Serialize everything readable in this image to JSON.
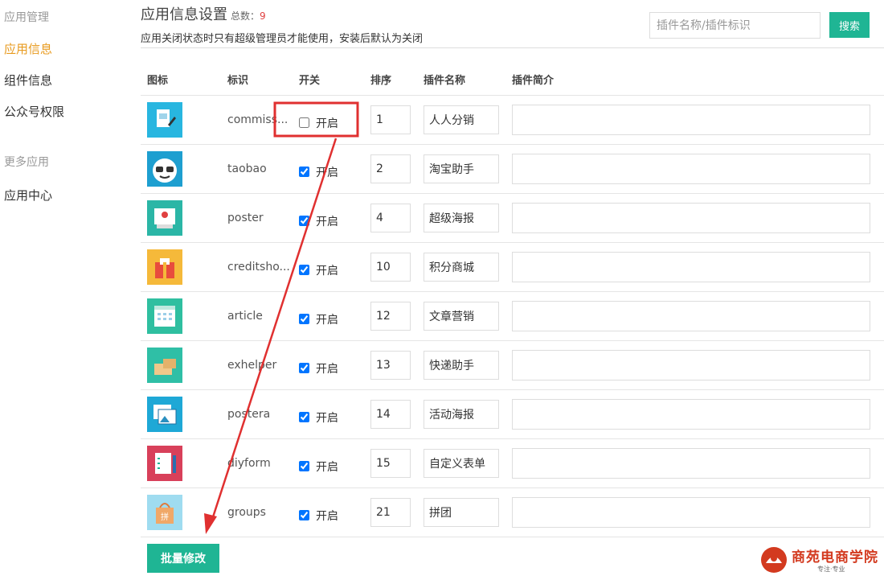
{
  "sidebar": {
    "group1": "应用管理",
    "items1": [
      "应用信息",
      "组件信息",
      "公众号权限"
    ],
    "group2": "更多应用",
    "items2": [
      "应用中心"
    ]
  },
  "header": {
    "title": "应用信息设置",
    "count_label": "总数：",
    "count_value": "9",
    "subtitle": "应用关闭状态时只有超级管理员才能使用，安装后默认为关闭"
  },
  "search": {
    "placeholder": "插件名称/插件标识",
    "button": "搜索"
  },
  "table": {
    "headers": [
      "图标",
      "标识",
      "开关",
      "排序",
      "插件名称",
      "插件简介"
    ],
    "switch_label": "开启",
    "rows": [
      {
        "ident": "commiss...",
        "checked": false,
        "order": "1",
        "name": "人人分销",
        "icon": "commission-icon",
        "color": "#28b6e0"
      },
      {
        "ident": "taobao",
        "checked": true,
        "order": "2",
        "name": "淘宝助手",
        "icon": "taobao-glasses-icon",
        "color": "#1e9fd0"
      },
      {
        "ident": "poster",
        "checked": true,
        "order": "4",
        "name": "超级海报",
        "icon": "poster-icon",
        "color": "#2bb6a6"
      },
      {
        "ident": "creditsho...",
        "checked": true,
        "order": "10",
        "name": "积分商城",
        "icon": "gift-bag-icon",
        "color": "#f5b93a"
      },
      {
        "ident": "article",
        "checked": true,
        "order": "12",
        "name": "文章营销",
        "icon": "article-icon",
        "color": "#2fbfa0"
      },
      {
        "ident": "exhelper",
        "checked": true,
        "order": "13",
        "name": "快递助手",
        "icon": "package-icon",
        "color": "#2fbfa6"
      },
      {
        "ident": "postera",
        "checked": true,
        "order": "14",
        "name": "活动海报",
        "icon": "photo-icon",
        "color": "#1ea8d6"
      },
      {
        "ident": "diyform",
        "checked": true,
        "order": "15",
        "name": "自定义表单",
        "icon": "form-icon",
        "color": "#d8405a"
      },
      {
        "ident": "groups",
        "checked": true,
        "order": "21",
        "name": "拼团",
        "icon": "group-bag-icon",
        "color": "#9fdcf0"
      }
    ]
  },
  "footer": {
    "batch_button": "批量修改"
  },
  "logo": {
    "text": "商苑电商学院",
    "sub": "专注·专业"
  },
  "annotation_color": "#e03030"
}
